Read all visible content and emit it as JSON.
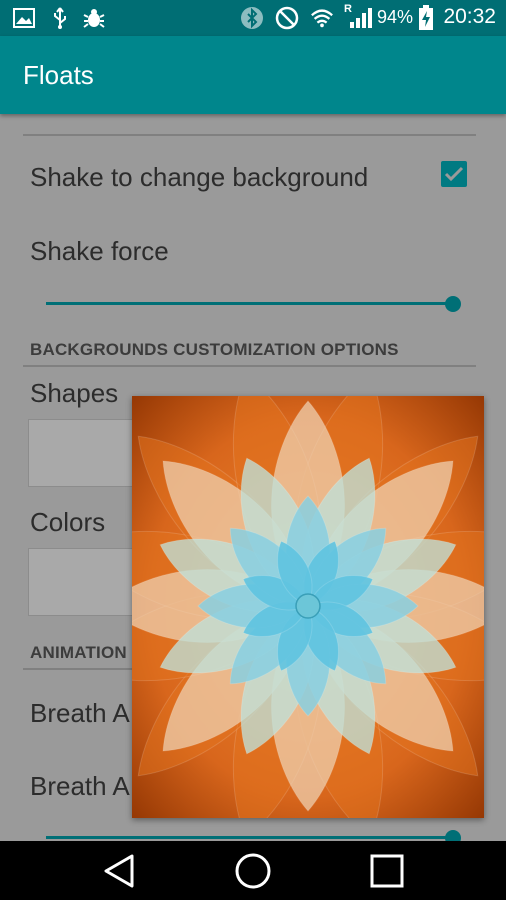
{
  "status_bar": {
    "battery_percent": "94%",
    "time": "20:32",
    "network_label": "R",
    "icons": [
      "image-icon",
      "usb-icon",
      "bug-icon",
      "bluetooth-icon",
      "do-not-disturb-icon",
      "wifi-icon",
      "signal-icon",
      "battery-charging-icon"
    ]
  },
  "app_bar": {
    "title": "Floats"
  },
  "settings": {
    "shake_to_change": {
      "label": "Shake to change background",
      "checked": true
    },
    "shake_force": {
      "label": "Shake force",
      "value": 1.0
    },
    "backgrounds_header": "BACKGROUNDS CUSTOMIZATION  OPTIONS",
    "shapes_label": "Shapes",
    "colors_label": "Colors",
    "animation_header": "ANIMATION",
    "breath_a_1": "Breath A",
    "breath_a_2": "Breath A",
    "breath_slider_value": 1.0
  },
  "colors": {
    "primary": "#00868c",
    "primary_dark": "#006e74",
    "accent": "#007a82",
    "preview_bg": "#9a3a00"
  },
  "nav_bar": {
    "icons": [
      "back-icon",
      "home-icon",
      "recent-apps-icon"
    ]
  }
}
